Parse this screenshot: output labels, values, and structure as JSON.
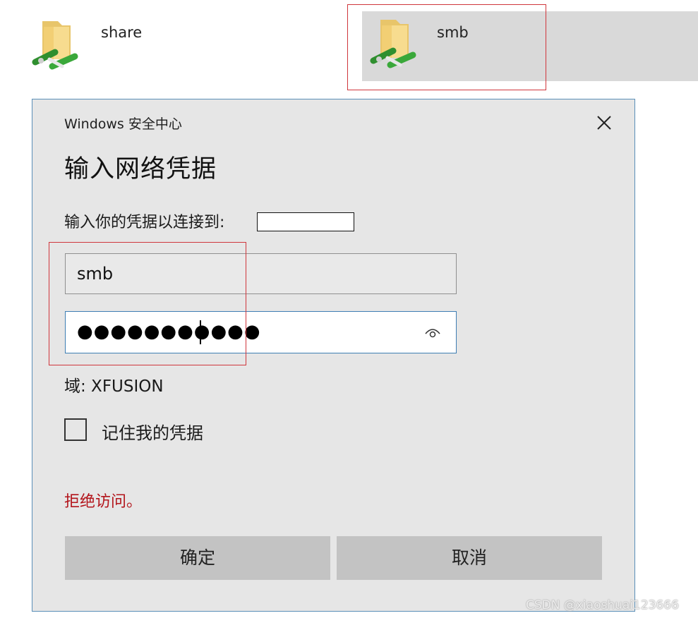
{
  "explorer": {
    "items": [
      {
        "label": "share",
        "icon": "network-folder-icon",
        "selected": false
      },
      {
        "label": "smb",
        "icon": "network-folder-icon",
        "selected": true
      }
    ]
  },
  "dialog": {
    "caption": "Windows 安全中心",
    "title": "输入网络凭据",
    "prompt": "输入你的凭据以连接到:",
    "username": "smb",
    "password_mask": "●●●●●●●●●●●",
    "domain": "域: XFUSION",
    "remember_label": "记住我的凭据",
    "remember_checked": false,
    "error": "拒绝访问。",
    "ok_label": "确定",
    "cancel_label": "取消"
  },
  "icons": {
    "close": "close-icon",
    "reveal": "eye-icon"
  },
  "colors": {
    "dialog_bg": "#e6e6e6",
    "accent_border": "#3e7eb3",
    "error": "#b3141b",
    "annotation": "#d0363c",
    "selected_bg": "#d9d9d9"
  },
  "watermark": "CSDN @xiaoshuai123666"
}
